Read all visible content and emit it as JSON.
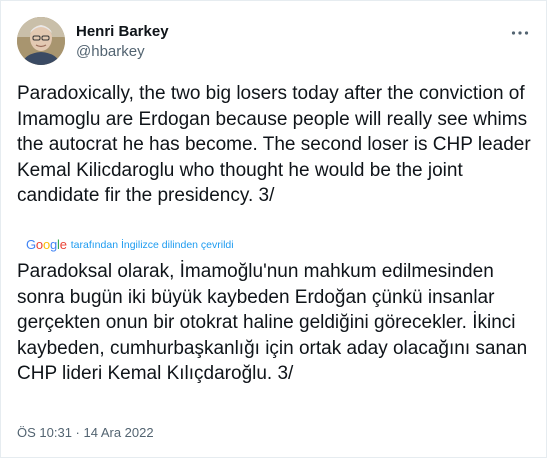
{
  "user": {
    "display_name": "Henri Barkey",
    "handle": "@hbarkey"
  },
  "more_menu": {
    "icon": "more-horizontal-icon"
  },
  "tweet": {
    "text": "Paradoxically, the two big losers today after the conviction of Imamoglu are Erdogan because people will really see whims the autocrat he has become. The second loser is CHP leader Kemal Kilicdaroglu who thought he would be the joint candidate fir the presidency. 3/",
    "timestamp": "ÖS 10:31 · 14 Ara 2022"
  },
  "translation": {
    "provider_logo": "Google",
    "attribution": "tarafından İngilizce dilinden çevrildi",
    "text": "Paradoksal olarak, İmamoğlu'nun mahkum edilmesinden sonra bugün iki büyük kaybeden Erdoğan çünkü insanlar gerçekten onun bir otokrat haline geldiğini görecekler. İkinci kaybeden, cumhurbaşkanlığı için ortak aday olacağını sanan CHP lideri Kemal Kılıçdaroğlu. 3/"
  },
  "colors": {
    "text_primary": "#0f1419",
    "text_secondary": "#536471",
    "google_blue": "#4285F4",
    "google_red": "#EA4335",
    "google_yellow": "#FBBC05",
    "google_green": "#34A853"
  }
}
